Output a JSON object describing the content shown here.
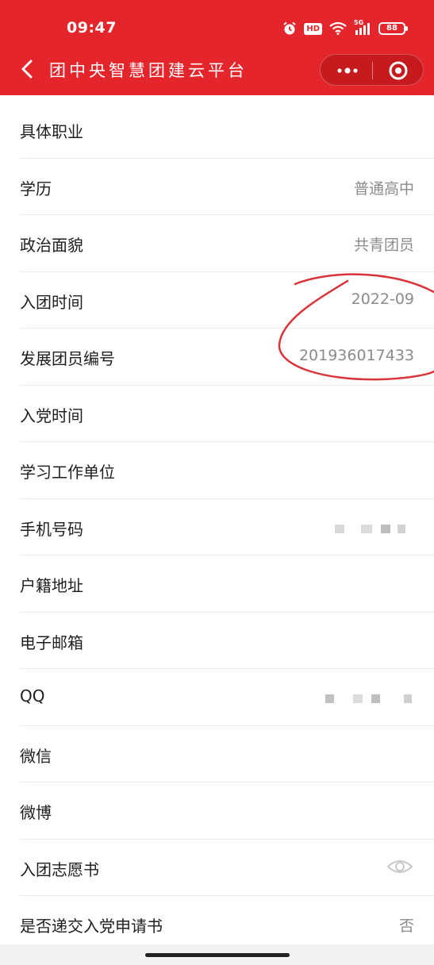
{
  "status_bar": {
    "time": "09:47",
    "hd": "HD",
    "network": "5G",
    "battery": "88"
  },
  "nav": {
    "title": "团中央智慧团建云平台"
  },
  "colors": {
    "brand_red": "#e4262c",
    "value_gray": "#8b8b8b",
    "annotation_red": "#d8343a"
  },
  "icons": {
    "back": "chevron-left-icon",
    "more": "more-dots-icon",
    "close": "target-circle-icon",
    "eye": "eye-icon"
  },
  "form": {
    "rows": [
      {
        "label": "具体职业",
        "value": ""
      },
      {
        "label": "学历",
        "value": "普通高中"
      },
      {
        "label": "政治面貌",
        "value": "共青团员"
      },
      {
        "label": "入团时间",
        "value": "2022-09"
      },
      {
        "label": "发展团员编号",
        "value": "201936017433"
      },
      {
        "label": "入党时间",
        "value": ""
      },
      {
        "label": "学习工作单位",
        "value": ""
      },
      {
        "label": "手机号码",
        "value": ""
      },
      {
        "label": "户籍地址",
        "value": ""
      },
      {
        "label": "电子邮箱",
        "value": ""
      },
      {
        "label": "QQ",
        "value": ""
      },
      {
        "label": "微信",
        "value": ""
      },
      {
        "label": "微博",
        "value": ""
      },
      {
        "label": "入团志愿书",
        "value": ""
      },
      {
        "label": "是否递交入党申请书",
        "value": "否"
      }
    ]
  }
}
